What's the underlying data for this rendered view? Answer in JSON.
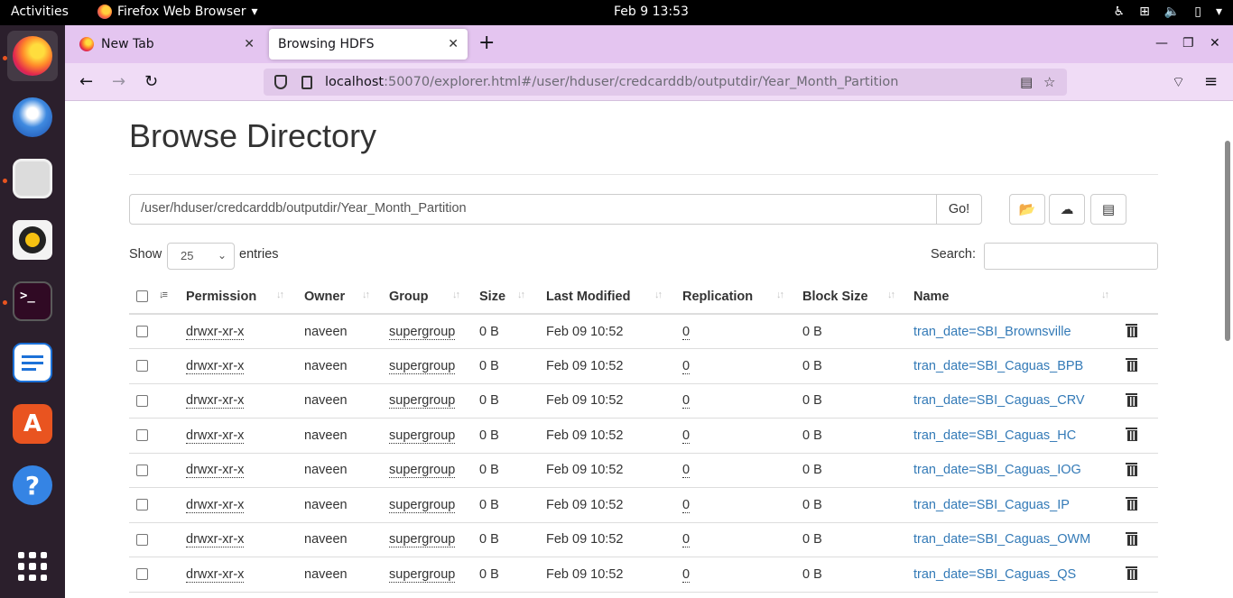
{
  "topbar": {
    "activities": "Activities",
    "app_name": "Firefox Web Browser",
    "clock": "Feb 9  13:53"
  },
  "tabs": [
    {
      "label": "New Tab"
    },
    {
      "label": "Browsing HDFS"
    }
  ],
  "url": {
    "host": "localhost",
    "rest": ":50070/explorer.html#/user/hduser/credcarddb/outputdir/Year_Month_Partition"
  },
  "page": {
    "title": "Browse Directory",
    "path_value": "/user/hduser/credcarddb/outputdir/Year_Month_Partition",
    "go_label": "Go!",
    "show_label": "Show",
    "entries_value": "25",
    "entries_label": "entries",
    "search_label": "Search:"
  },
  "table": {
    "headers": {
      "permission": "Permission",
      "owner": "Owner",
      "group": "Group",
      "size": "Size",
      "last_modified": "Last Modified",
      "replication": "Replication",
      "block_size": "Block Size",
      "name": "Name"
    },
    "rows": [
      {
        "permission": "drwxr-xr-x",
        "owner": "naveen",
        "group": "supergroup",
        "size": "0 B",
        "last_modified": "Feb 09 10:52",
        "replication": "0",
        "block_size": "0 B",
        "name": "tran_date=SBI_Brownsville"
      },
      {
        "permission": "drwxr-xr-x",
        "owner": "naveen",
        "group": "supergroup",
        "size": "0 B",
        "last_modified": "Feb 09 10:52",
        "replication": "0",
        "block_size": "0 B",
        "name": "tran_date=SBI_Caguas_BPB"
      },
      {
        "permission": "drwxr-xr-x",
        "owner": "naveen",
        "group": "supergroup",
        "size": "0 B",
        "last_modified": "Feb 09 10:52",
        "replication": "0",
        "block_size": "0 B",
        "name": "tran_date=SBI_Caguas_CRV"
      },
      {
        "permission": "drwxr-xr-x",
        "owner": "naveen",
        "group": "supergroup",
        "size": "0 B",
        "last_modified": "Feb 09 10:52",
        "replication": "0",
        "block_size": "0 B",
        "name": "tran_date=SBI_Caguas_HC"
      },
      {
        "permission": "drwxr-xr-x",
        "owner": "naveen",
        "group": "supergroup",
        "size": "0 B",
        "last_modified": "Feb 09 10:52",
        "replication": "0",
        "block_size": "0 B",
        "name": "tran_date=SBI_Caguas_IOG"
      },
      {
        "permission": "drwxr-xr-x",
        "owner": "naveen",
        "group": "supergroup",
        "size": "0 B",
        "last_modified": "Feb 09 10:52",
        "replication": "0",
        "block_size": "0 B",
        "name": "tran_date=SBI_Caguas_IP"
      },
      {
        "permission": "drwxr-xr-x",
        "owner": "naveen",
        "group": "supergroup",
        "size": "0 B",
        "last_modified": "Feb 09 10:52",
        "replication": "0",
        "block_size": "0 B",
        "name": "tran_date=SBI_Caguas_OWM"
      },
      {
        "permission": "drwxr-xr-x",
        "owner": "naveen",
        "group": "supergroup",
        "size": "0 B",
        "last_modified": "Feb 09 10:52",
        "replication": "0",
        "block_size": "0 B",
        "name": "tran_date=SBI_Caguas_QS"
      }
    ]
  },
  "colors": {
    "link": "#337ab7",
    "tabstrip": "#e4c5f0",
    "navbar": "#f0dcf6",
    "dock": "#2b1f2c"
  }
}
